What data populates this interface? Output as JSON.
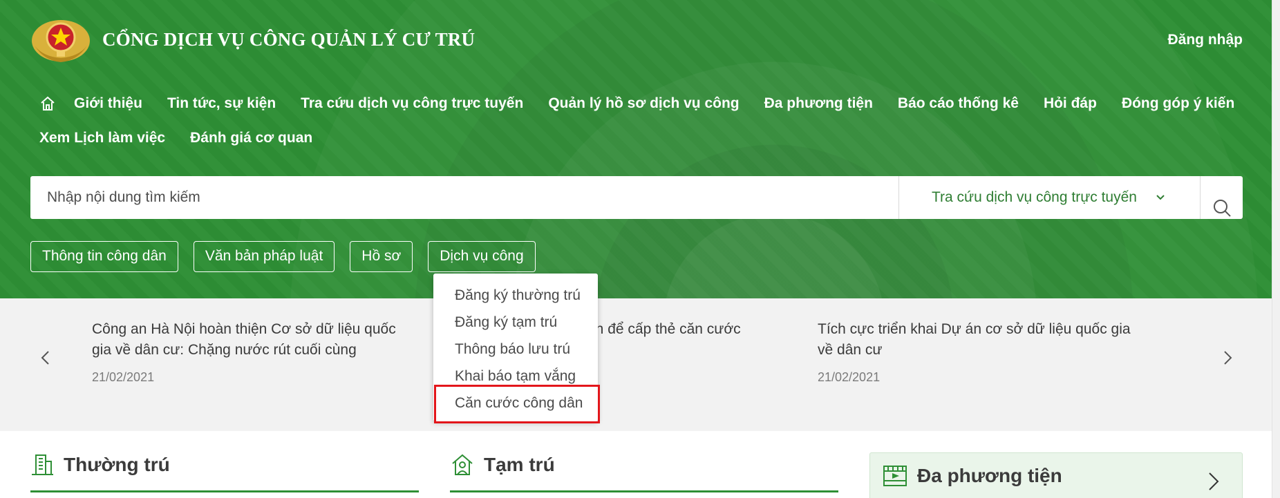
{
  "header": {
    "site_title": "CỔNG DỊCH VỤ CÔNG QUẢN LÝ CƯ TRÚ",
    "login_label": "Đăng nhập",
    "bg_color": "#2e8f35"
  },
  "nav": {
    "row1": [
      "Giới thiệu",
      "Tin tức, sự kiện",
      "Tra cứu dịch vụ công trực tuyến",
      "Quản lý hồ sơ dịch vụ công",
      "Đa phương tiện",
      "Báo cáo thống kê",
      "Hỏi đáp",
      "Đóng góp ý kiến"
    ],
    "row2": [
      "Xem Lịch làm việc",
      "Đánh giá cơ quan"
    ]
  },
  "search": {
    "placeholder": "Nhập nội dung tìm kiếm",
    "scope_selected": "Tra cứu dịch vụ công trực tuyến"
  },
  "quick_links": [
    "Thông tin công dân",
    "Văn bản pháp luật",
    "Hồ sơ",
    "Dịch vụ công"
  ],
  "dropdown": {
    "items": [
      "Đăng ký thường trú",
      "Đăng ký tạm trú",
      "Thông báo lưu trú",
      "Khai báo tạm vắng",
      "Căn cước công dân"
    ],
    "highlighted_index": 4,
    "highlight_color": "#e3161b"
  },
  "news": [
    {
      "title": "Công an Hà Nội hoàn thiện Cơ sở dữ liệu quốc gia về dân cư: Chặng nước rút cuối cùng",
      "date": "21/02/2021"
    },
    {
      "title": "ện để cấp thẻ căn cước",
      "date": ""
    },
    {
      "title": "Tích cực triển khai Dự án cơ sở dữ liệu quốc gia về dân cư",
      "date": "21/02/2021"
    }
  ],
  "sections": {
    "thuong_tru": "Thường trú",
    "tam_tru": "Tạm trú",
    "da_phuong_tien": "Đa phương tiện"
  },
  "icons": {
    "home": "home-icon",
    "search": "search-icon",
    "chevron": "chevron-down-icon",
    "building": "building-icon",
    "house_person": "house-person-icon",
    "film": "film-icon"
  }
}
